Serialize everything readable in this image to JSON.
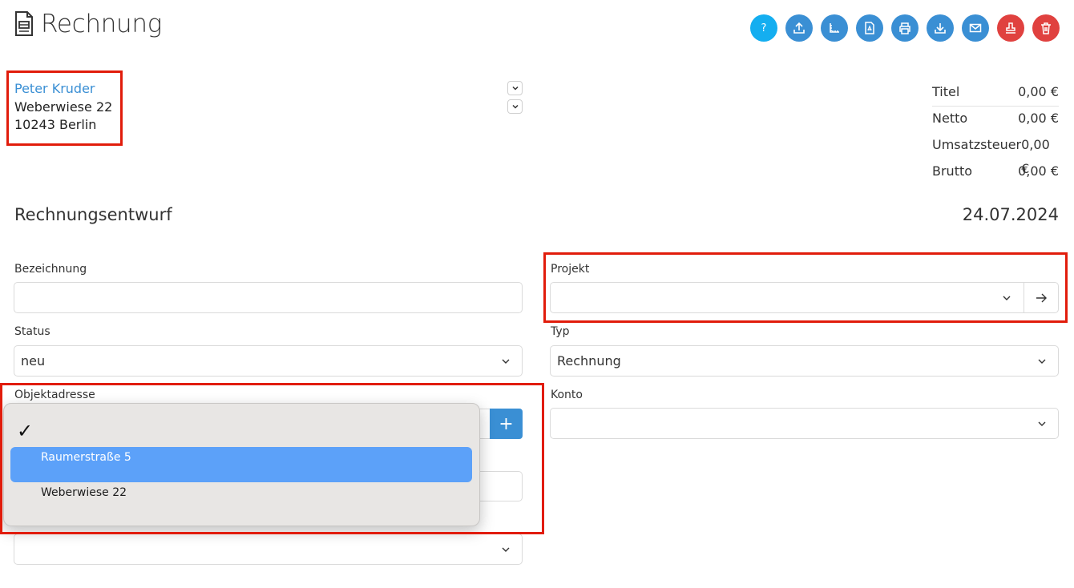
{
  "header": {
    "title": "Rechnung"
  },
  "toolbar": {
    "help_label": "?",
    "buttons": [
      "help-icon",
      "upload-icon",
      "ruler-icon",
      "pdf-icon",
      "print-icon",
      "download-icon",
      "mail-icon",
      "stamp-icon",
      "trash-icon"
    ]
  },
  "address": {
    "name": "Peter Kruder",
    "street": "Weberwiese 22",
    "city": "10243 Berlin"
  },
  "totals": [
    {
      "label": "Titel",
      "value": "0,00 €"
    },
    {
      "label": "Netto",
      "value": "0,00 €"
    },
    {
      "label": "Umsatzsteuer",
      "value": "0,00 €"
    },
    {
      "label": "Brutto",
      "value": "0,00 €"
    }
  ],
  "section": {
    "title": "Rechnungsentwurf",
    "date": "24.07.2024"
  },
  "form": {
    "bezeichnung": {
      "label": "Bezeichnung",
      "value": ""
    },
    "projekt": {
      "label": "Projekt",
      "value": ""
    },
    "status": {
      "label": "Status",
      "value": "neu"
    },
    "typ": {
      "label": "Typ",
      "value": "Rechnung"
    },
    "objektadresse": {
      "label": "Objektadresse"
    },
    "konto": {
      "label": "Konto",
      "value": ""
    }
  },
  "dropdown": {
    "checkmark": "✓",
    "options": [
      "Raumerstraße 5",
      "Weberwiese 22"
    ],
    "selected": "Raumerstraße 5"
  },
  "colors": {
    "accent": "#3a8fd4",
    "help": "#14aef0",
    "danger": "#e0413f",
    "highlight": "#e11c0b",
    "selection": "#5ca1f9"
  }
}
